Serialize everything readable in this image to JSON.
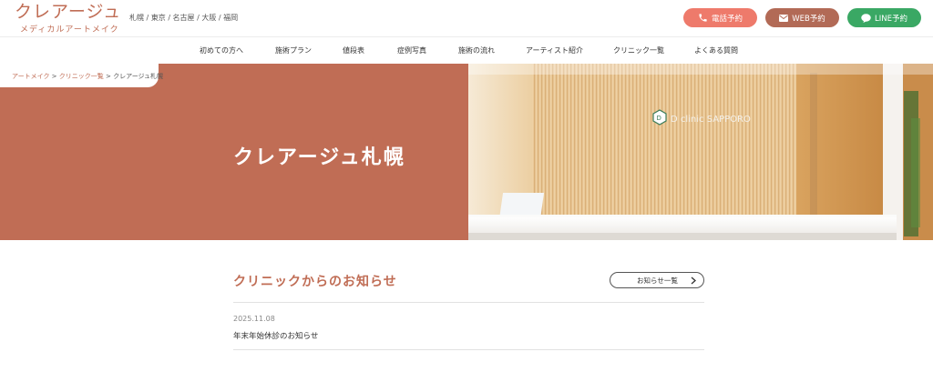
{
  "header": {
    "logo_main": "クレアージュ",
    "logo_sub": "メディカルアートメイク",
    "cities": "札幌 / 東京 / 名古屋 / 大阪 / 福岡",
    "cta_phone": "電話予約",
    "cta_web": "WEB予約",
    "cta_line": "LINE予約"
  },
  "nav": {
    "items": [
      "初めての方へ",
      "施術プラン",
      "値段表",
      "症例写真",
      "施術の流れ",
      "アーティスト紹介",
      "クリニック一覧",
      "よくある質問"
    ]
  },
  "breadcrumb": {
    "home": "アートメイク",
    "sep1": " > ",
    "list": "クリニック一覧",
    "sep2": " > ",
    "current": "クレアージュ札幌"
  },
  "hero": {
    "title": "クレアージュ札幌",
    "sign_text": "D clinic SAPPORO"
  },
  "notices": {
    "title": "クリニックからのお知らせ",
    "list_button": "お知らせ一覧",
    "items": [
      {
        "date": "2025.11.08",
        "text": "年末年始休診のお知らせ"
      }
    ]
  },
  "colors": {
    "brand": "#c06d55",
    "phone": "#ee7a6b",
    "web": "#b26a56",
    "line": "#3aa864"
  }
}
